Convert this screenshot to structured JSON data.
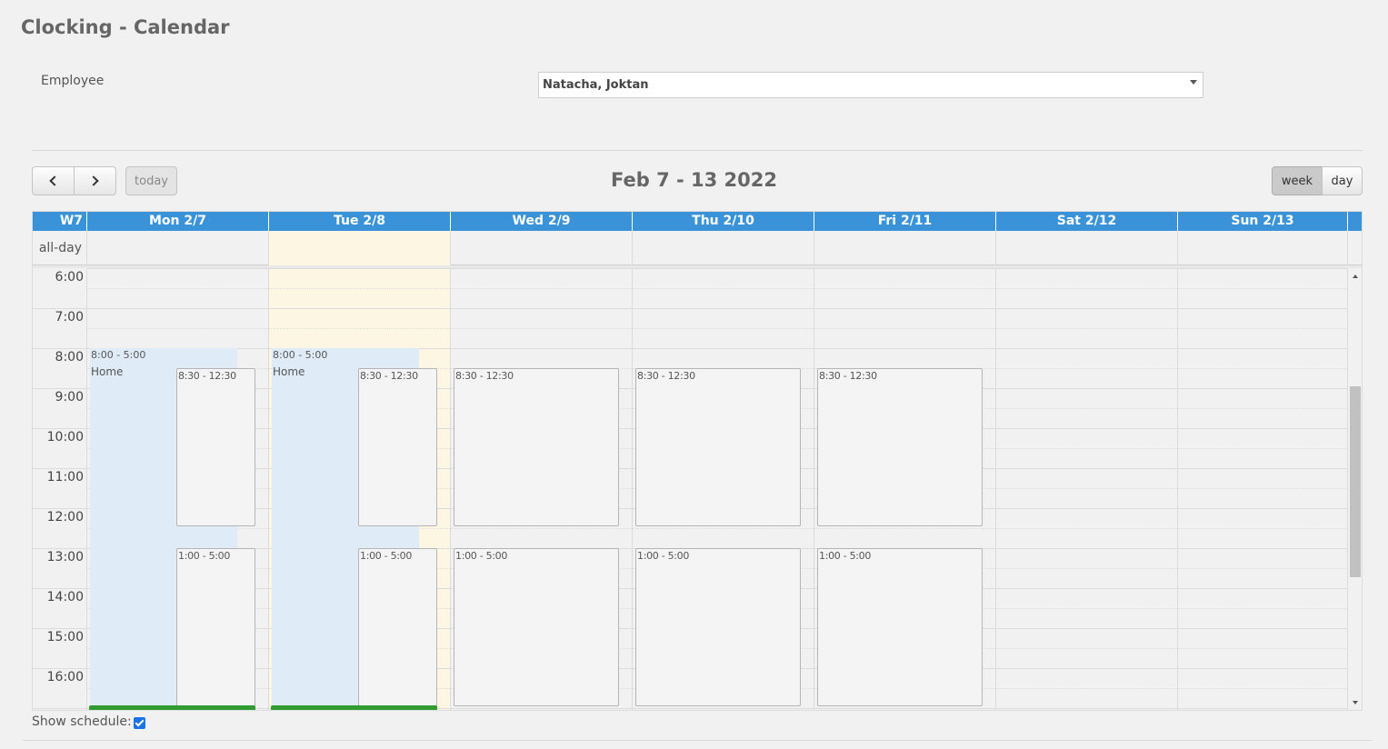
{
  "page": {
    "title": "Clocking - Calendar"
  },
  "employee": {
    "label": "Employee",
    "value": "Natacha, Joktan"
  },
  "toolbar": {
    "today_label": "today",
    "range_title": "Feb 7 - 13 2022",
    "week_label": "week",
    "day_label": "day",
    "active_view": "week"
  },
  "calendar": {
    "week_label": "W7",
    "allday_label": "all-day",
    "days": [
      "Mon 2/7",
      "Tue 2/8",
      "Wed 2/9",
      "Thu 2/10",
      "Fri 2/11",
      "Sat 2/12",
      "Sun 2/13"
    ],
    "today_index": 1,
    "hours": [
      "6:00",
      "7:00",
      "8:00",
      "9:00",
      "10:00",
      "11:00",
      "12:00",
      "13:00",
      "14:00",
      "15:00",
      "16:00"
    ],
    "background_events": [
      {
        "day": 0,
        "time": "8:00 - 5:00",
        "label": "Home"
      },
      {
        "day": 1,
        "time": "8:00 - 5:00",
        "label": "Home"
      }
    ],
    "events": [
      {
        "day": 0,
        "time": "8:30 - 12:30"
      },
      {
        "day": 1,
        "time": "8:30 - 12:30"
      },
      {
        "day": 2,
        "time": "8:30 - 12:30"
      },
      {
        "day": 3,
        "time": "8:30 - 12:30"
      },
      {
        "day": 4,
        "time": "8:30 - 12:30"
      },
      {
        "day": 0,
        "time": "1:00 - 5:00"
      },
      {
        "day": 1,
        "time": "1:00 - 5:00"
      },
      {
        "day": 2,
        "time": "1:00 - 5:00"
      },
      {
        "day": 3,
        "time": "1:00 - 5:00"
      },
      {
        "day": 4,
        "time": "1:00 - 5:00"
      }
    ],
    "clocked_days": [
      0,
      1
    ],
    "colors": {
      "header": "#3a93d8",
      "today": "#fdf6e3",
      "background_event": "#dfecf8",
      "clocked": "#2f9b31"
    }
  },
  "footer": {
    "show_schedule_label": "Show schedule:",
    "show_schedule_checked": true
  }
}
